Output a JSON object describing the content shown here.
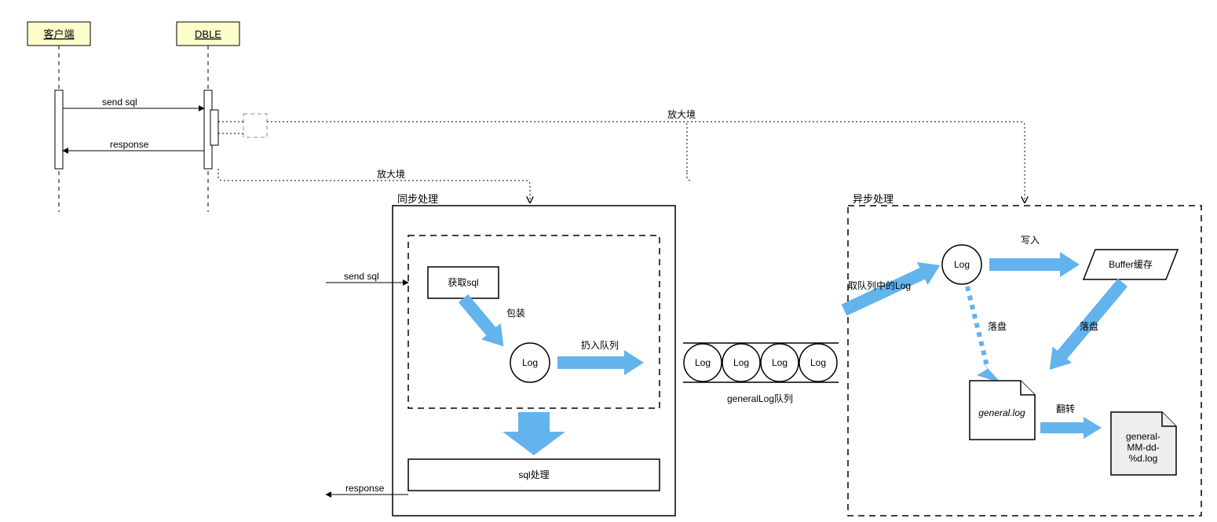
{
  "sequence": {
    "actors": {
      "client": "客户端",
      "dble": "DBLE"
    },
    "messages": {
      "send_sql": "send sql",
      "response": "response"
    },
    "magnifier_label": "放大境"
  },
  "sync_block": {
    "title": "同步处理",
    "get_sql": "获取sql",
    "wrap": "包装",
    "log": "Log",
    "enqueue": "扔入队列",
    "sql_process": "sql处理",
    "inbound": "send sql",
    "outbound": "response"
  },
  "queue": {
    "item": "Log",
    "name": "generalLog队列",
    "dequeue_label": "取队列中的Log"
  },
  "async_block": {
    "title": "异步处理",
    "log": "Log",
    "write": "写入",
    "buffer": "Buffer缓存",
    "flush1": "落盘",
    "flush2": "落盘",
    "file_general": "general.log",
    "rotate": "翻转",
    "file_rotated": "general-MM-dd-%d.log"
  }
}
